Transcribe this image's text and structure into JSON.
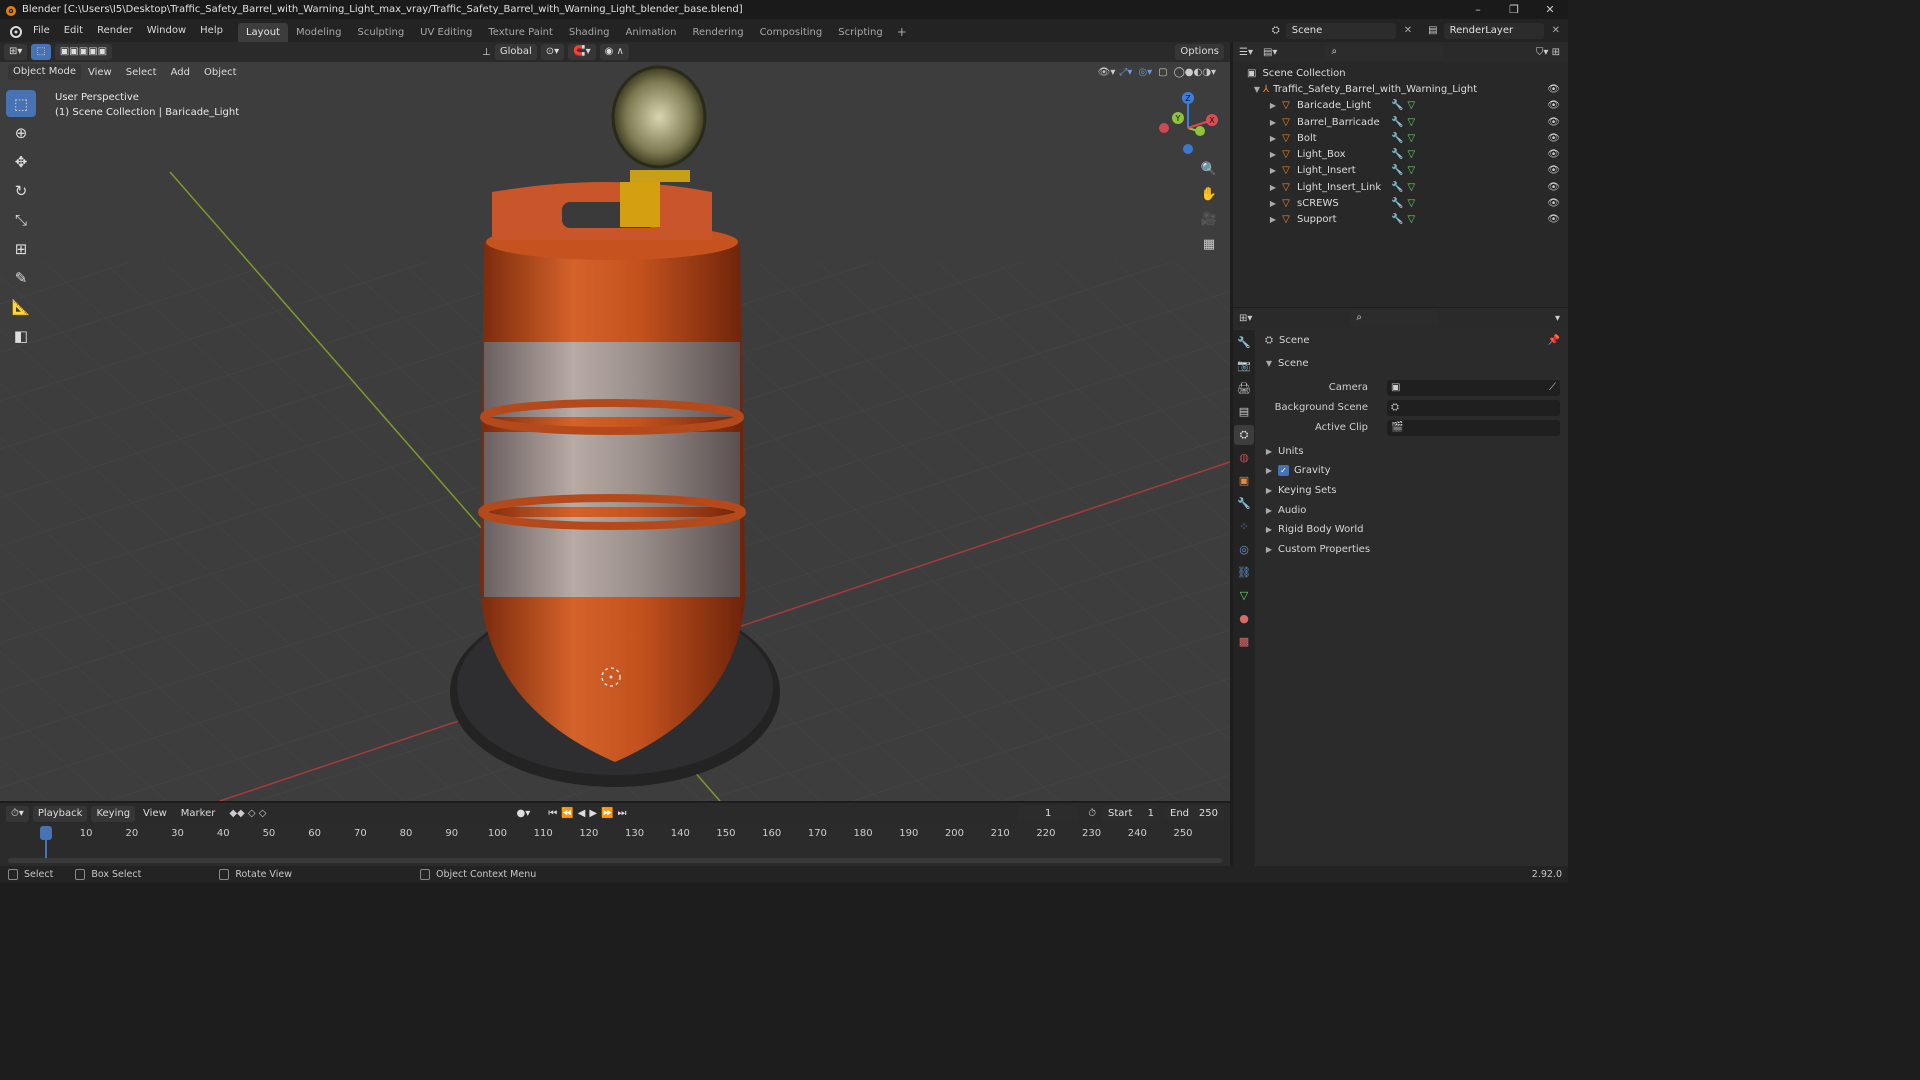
{
  "window": {
    "title": "Blender [C:\\Users\\I5\\Desktop\\Traffic_Safety_Barrel_with_Warning_Light_max_vray/Traffic_Safety_Barrel_with_Warning_Light_blender_base.blend]",
    "minimize": "–",
    "maximize": "❐",
    "close": "✕"
  },
  "menu": [
    "File",
    "Edit",
    "Render",
    "Window",
    "Help"
  ],
  "workspaces": [
    "Layout",
    "Modeling",
    "Sculpting",
    "UV Editing",
    "Texture Paint",
    "Shading",
    "Animation",
    "Rendering",
    "Compositing",
    "Scripting"
  ],
  "active_workspace": "Layout",
  "scene_name": "Scene",
  "view_layer": "RenderLayer",
  "header": {
    "transform_orientation": "Global",
    "options": "Options"
  },
  "viewport": {
    "mode": "Object Mode",
    "menus": [
      "View",
      "Select",
      "Add",
      "Object"
    ],
    "perspective": "User Perspective",
    "collection_info": "(1) Scene Collection | Baricade_Light"
  },
  "outliner": {
    "root": "Scene Collection",
    "collection": "Traffic_Safety_Barrel_with_Warning_Light",
    "objects": [
      "Baricade_Light",
      "Barrel_Barricade",
      "Bolt",
      "Light_Box",
      "Light_Insert",
      "Light_Insert_Link",
      "sCREWS",
      "Support"
    ]
  },
  "properties": {
    "context": "Scene",
    "section": "Scene",
    "fields": [
      {
        "label": "Camera",
        "value": ""
      },
      {
        "label": "Background Scene",
        "value": ""
      },
      {
        "label": "Active Clip",
        "value": ""
      }
    ],
    "panels": [
      "Units",
      "Gravity",
      "Keying Sets",
      "Audio",
      "Rigid Body World",
      "Custom Properties"
    ],
    "gravity_checked": true
  },
  "timeline": {
    "menus": [
      "Playback",
      "Keying",
      "View",
      "Marker"
    ],
    "current_frame": "1",
    "start_label": "Start",
    "start": "1",
    "end_label": "End",
    "end": "250",
    "ticks": [
      "1",
      "10",
      "20",
      "30",
      "40",
      "50",
      "60",
      "70",
      "80",
      "90",
      "100",
      "110",
      "120",
      "130",
      "140",
      "150",
      "160",
      "170",
      "180",
      "190",
      "200",
      "210",
      "220",
      "230",
      "240",
      "250"
    ]
  },
  "status": {
    "select": "Select",
    "box_select": "Box Select",
    "rotate": "Rotate View",
    "context_menu": "Object Context Menu",
    "version": "2.92.0"
  },
  "gizmo": {
    "x": "X",
    "y": "Y",
    "z": "Z"
  },
  "colors": {
    "accent": "#4772b3",
    "barrel_orange": "#c8501f",
    "x_axis": "#e04a54",
    "y_axis": "#8cc43a",
    "z_axis": "#3c7ee0"
  }
}
